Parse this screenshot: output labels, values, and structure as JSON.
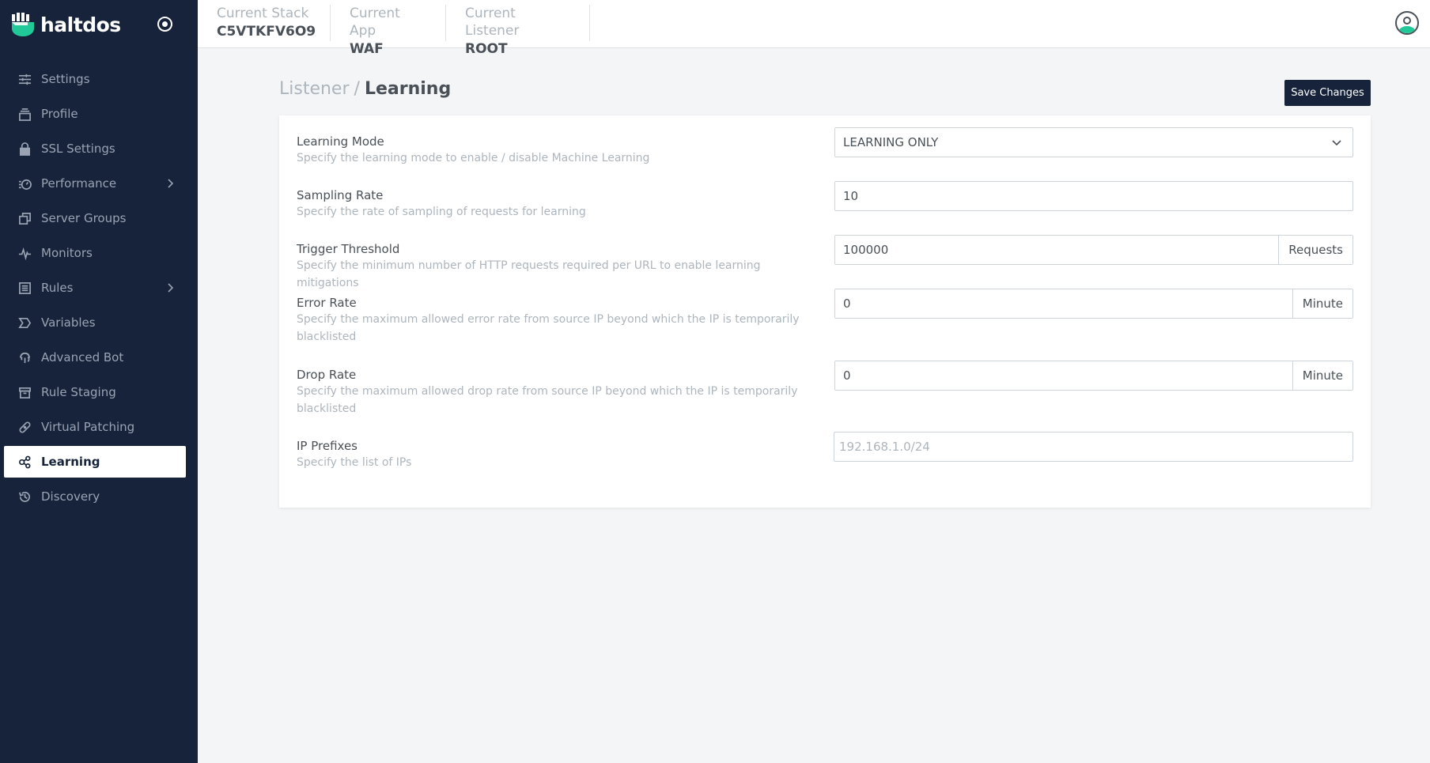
{
  "app": {
    "brand_name": "haltdos"
  },
  "sidebar": {
    "items": [
      {
        "label": "Settings",
        "icon": "sliders-icon",
        "has_chevron": false,
        "active": false
      },
      {
        "label": "Profile",
        "icon": "stack-icon",
        "has_chevron": false,
        "active": false
      },
      {
        "label": "SSL Settings",
        "icon": "lock-icon",
        "has_chevron": false,
        "active": false
      },
      {
        "label": "Performance",
        "icon": "speedometer-icon",
        "has_chevron": true,
        "active": false
      },
      {
        "label": "Server Groups",
        "icon": "server-group-icon",
        "has_chevron": false,
        "active": false
      },
      {
        "label": "Monitors",
        "icon": "pulse-icon",
        "has_chevron": false,
        "active": false
      },
      {
        "label": "Rules",
        "icon": "list-icon",
        "has_chevron": true,
        "active": false
      },
      {
        "label": "Variables",
        "icon": "tag-icon",
        "has_chevron": false,
        "active": false
      },
      {
        "label": "Advanced Bot",
        "icon": "fingerprint-icon",
        "has_chevron": false,
        "active": false
      },
      {
        "label": "Rule Staging",
        "icon": "archive-icon",
        "has_chevron": false,
        "active": false
      },
      {
        "label": "Virtual Patching",
        "icon": "bandage-icon",
        "has_chevron": false,
        "active": false
      },
      {
        "label": "Learning",
        "icon": "network-icon",
        "has_chevron": false,
        "active": true
      },
      {
        "label": "Discovery",
        "icon": "history-icon",
        "has_chevron": false,
        "active": false
      }
    ]
  },
  "topbar": {
    "stack_label": "Current Stack",
    "stack_value": "C5VTKFV6O9",
    "app_label": "Current App",
    "app_value": "WAF",
    "listener_label": "Current Listener",
    "listener_value": "ROOT"
  },
  "page": {
    "breadcrumb_parent": "Listener",
    "breadcrumb_sep": "/",
    "breadcrumb_current": "Learning",
    "save_label": "Save Changes"
  },
  "form": {
    "learning_mode": {
      "title": "Learning Mode",
      "desc": "Specify the learning mode to enable / disable Machine Learning",
      "value": "LEARNING ONLY"
    },
    "sampling_rate": {
      "title": "Sampling Rate",
      "desc": "Specify the rate of sampling of requests for learning",
      "value": "10"
    },
    "trigger_threshold": {
      "title": "Trigger Threshold",
      "desc": "Specify the minimum number of HTTP requests required per URL to enable learning mitigations",
      "value": "100000",
      "unit": "Requests"
    },
    "error_rate": {
      "title": "Error Rate",
      "desc": "Specify the maximum allowed error rate from source IP beyond which the IP is temporarily blacklisted",
      "value": "0",
      "unit": "Minute"
    },
    "drop_rate": {
      "title": "Drop Rate",
      "desc": "Specify the maximum allowed drop rate from source IP beyond which the IP is temporarily blacklisted",
      "value": "0",
      "unit": "Minute"
    },
    "ip_prefixes": {
      "title": "IP Prefixes",
      "desc": "Specify the list of IPs",
      "placeholder": "192.168.1.0/24"
    }
  },
  "colors": {
    "sidebar_bg": "#17233a",
    "accent_green": "#20c997",
    "button_bg": "#17233a"
  }
}
